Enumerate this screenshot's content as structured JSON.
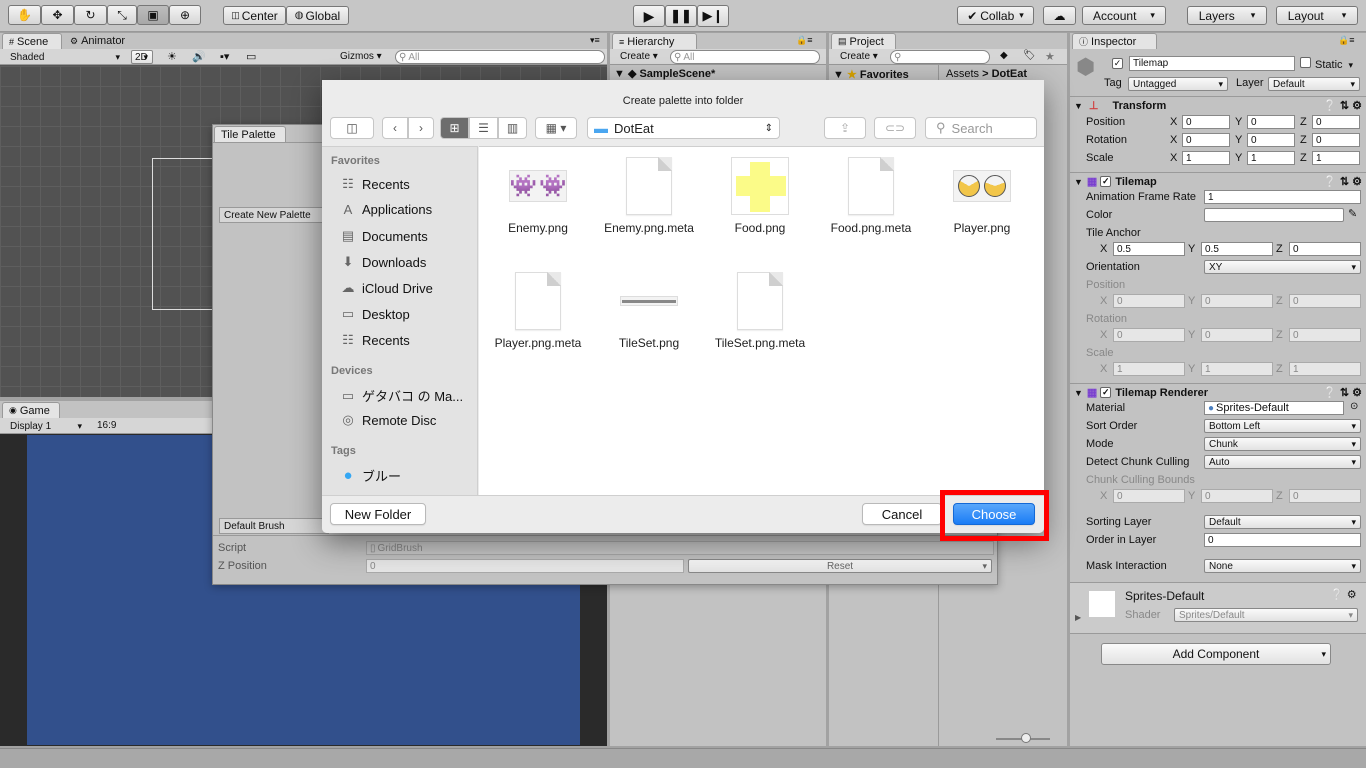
{
  "toolbar": {
    "pivot": "Center",
    "space": "Global",
    "collab": "Collab",
    "account": "Account",
    "layers": "Layers",
    "layout": "Layout"
  },
  "scene": {
    "tab_scene": "Scene",
    "tab_animator": "Animator",
    "shading": "Shaded",
    "mode_2d": "2D",
    "gizmos": "Gizmos",
    "search_placeholder": "All"
  },
  "game": {
    "tab": "Game",
    "display": "Display 1",
    "aspect": "16:9"
  },
  "hierarchy": {
    "tab": "Hierarchy",
    "create": "Create",
    "search_placeholder": "All",
    "scene_name": "SampleScene*"
  },
  "project": {
    "tab": "Project",
    "create": "Create",
    "favorites": "Favorites",
    "breadcrumb_assets": "Assets",
    "breadcrumb_sep": ">",
    "breadcrumb_folder": "DotEat"
  },
  "tile_palette": {
    "tab": "Tile Palette",
    "create_new": "Create New Palette",
    "default_brush": "Default Brush",
    "script_label": "Script",
    "script_value": "GridBrush",
    "zpos_label": "Z Position",
    "zpos_value": "0",
    "reset": "Reset"
  },
  "dialog": {
    "title": "Create palette into folder",
    "folder": "DotEat",
    "search_placeholder": "Search",
    "favorites_head": "Favorites",
    "favorites": [
      "Recents",
      "Applications",
      "Documents",
      "Downloads",
      "iCloud Drive",
      "Desktop",
      "Recents"
    ],
    "devices_head": "Devices",
    "devices": [
      "ゲタバコ の Ma...",
      "Remote Disc"
    ],
    "tags_head": "Tags",
    "tags": [
      "ブルー"
    ],
    "files": [
      "Enemy.png",
      "Enemy.png.meta",
      "Food.png",
      "Food.png.meta",
      "Player.png",
      "Player.png.meta",
      "TileSet.png",
      "TileSet.png.meta"
    ],
    "new_folder": "New Folder",
    "cancel": "Cancel",
    "choose": "Choose",
    "accent": "#1a7cf5",
    "highlight": "#ff0000"
  },
  "inspector": {
    "tab": "Inspector",
    "object_name": "Tilemap",
    "static_label": "Static",
    "tag_label": "Tag",
    "tag_value": "Untagged",
    "layer_label": "Layer",
    "layer_value": "Default",
    "transform": {
      "title": "Transform",
      "position_label": "Position",
      "rotation_label": "Rotation",
      "scale_label": "Scale",
      "x": "X",
      "y": "Y",
      "z": "Z",
      "position": [
        "0",
        "0",
        "0"
      ],
      "rotation": [
        "0",
        "0",
        "0"
      ],
      "scale": [
        "1",
        "1",
        "1"
      ]
    },
    "tilemap": {
      "title": "Tilemap",
      "frame_rate_label": "Animation Frame Rate",
      "frame_rate": "1",
      "color_label": "Color",
      "anchor_label": "Tile Anchor",
      "anchor": [
        "0.5",
        "0.5",
        "0"
      ],
      "orientation_label": "Orientation",
      "orientation": "XY",
      "position_label": "Position",
      "rotation_label": "Rotation",
      "scale_label": "Scale",
      "position": [
        "0",
        "0",
        "0"
      ],
      "rotation": [
        "0",
        "0",
        "0"
      ],
      "scale": [
        "1",
        "1",
        "1"
      ]
    },
    "renderer": {
      "title": "Tilemap Renderer",
      "material_label": "Material",
      "material": "Sprites-Default",
      "sort_order_label": "Sort Order",
      "sort_order": "Bottom Left",
      "mode_label": "Mode",
      "mode": "Chunk",
      "culling_label": "Detect Chunk Culling",
      "culling": "Auto",
      "bounds_label": "Chunk Culling Bounds",
      "bounds": [
        "0",
        "0",
        "0"
      ],
      "sorting_layer_label": "Sorting Layer",
      "sorting_layer": "Default",
      "order_label": "Order in Layer",
      "order": "0",
      "mask_label": "Mask Interaction",
      "mask": "None"
    },
    "material": {
      "name": "Sprites-Default",
      "shader_label": "Shader",
      "shader": "Sprites/Default"
    },
    "add_component": "Add Component"
  }
}
